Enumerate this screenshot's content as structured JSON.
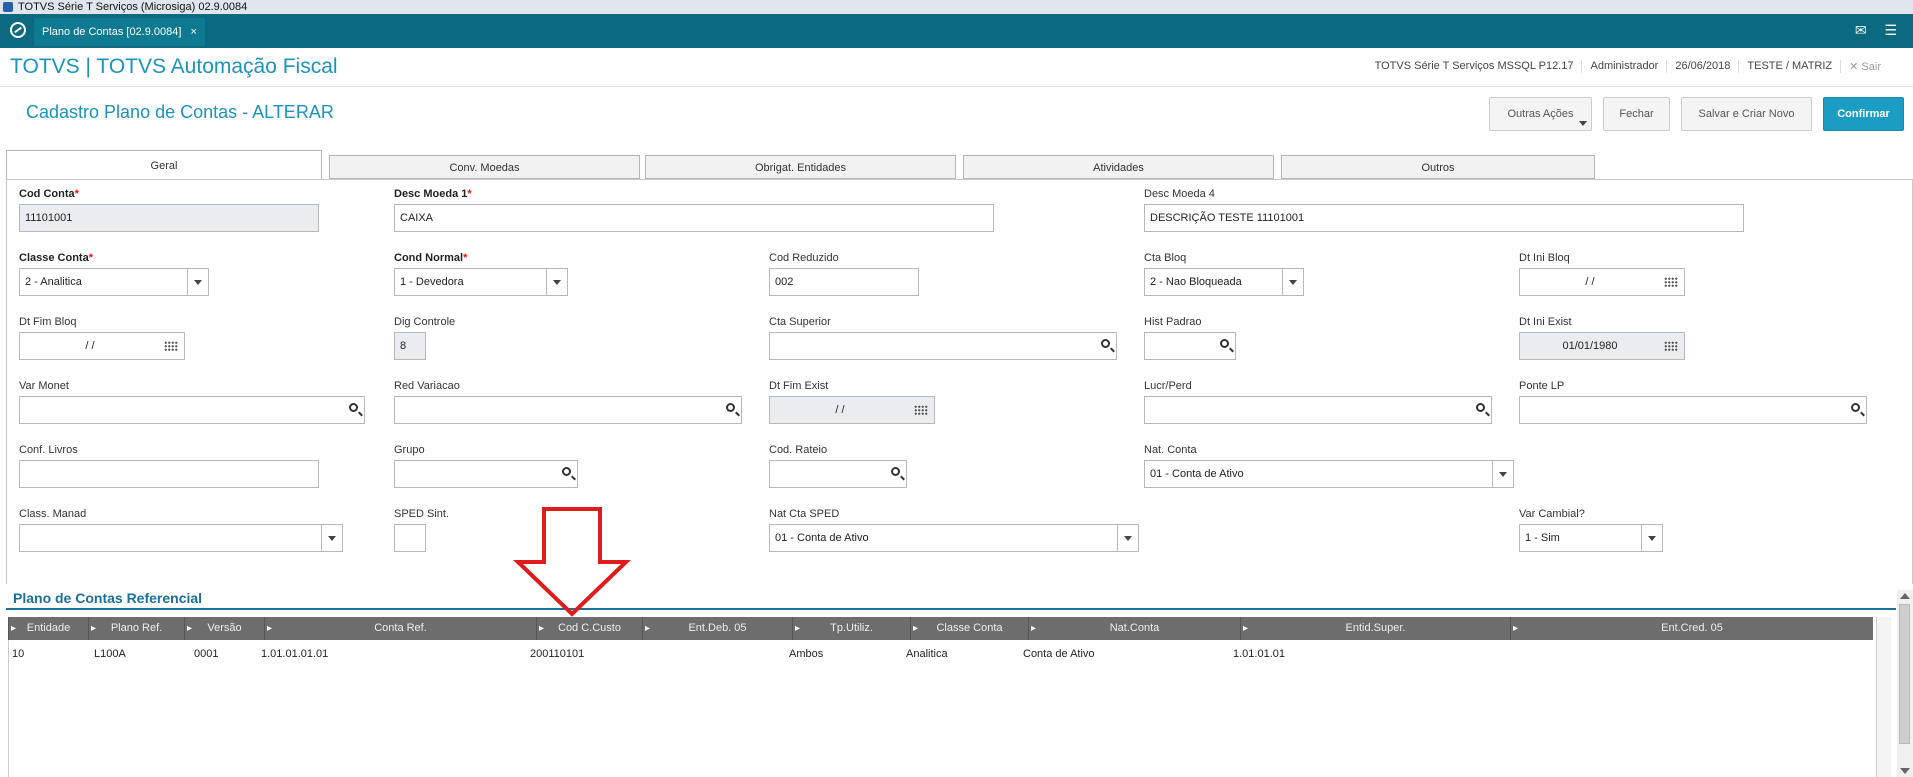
{
  "os": {
    "title": "TOTVS Série T Serviços (Microsiga) 02.9.0084"
  },
  "tabbar": {
    "tab_label": "Plano de Contas [02.9.0084]",
    "tab_close": "×",
    "mail_icon": "✉",
    "menu_icon": "☰"
  },
  "header": {
    "brand": "TOTVS | TOTVS Automação Fiscal",
    "env": "TOTVS Série T Serviços MSSQL P12.17",
    "user": "Administrador",
    "date": "26/06/2018",
    "company": "TESTE / MATRIZ",
    "logout": "✕  Sair"
  },
  "page": {
    "title": "Cadastro Plano de Contas - ALTERAR",
    "buttons": {
      "outras": "Outras Ações",
      "fechar": "Fechar",
      "salvar_novo": "Salvar e Criar Novo",
      "confirmar": "Confirmar"
    }
  },
  "tabs": [
    "Geral",
    "Conv. Moedas",
    "Obrigat. Entidades",
    "Atividades",
    "Outros"
  ],
  "fields": {
    "cod_conta": {
      "label": "Cod Conta",
      "value": "11101001"
    },
    "desc_moeda1": {
      "label": "Desc Moeda 1",
      "value": "CAIXA"
    },
    "desc_moeda4": {
      "label": "Desc Moeda 4",
      "value": "DESCRIÇÃO TESTE 11101001"
    },
    "classe_conta": {
      "label": "Classe Conta",
      "value": "2 - Analitica"
    },
    "cond_normal": {
      "label": "Cond Normal",
      "value": "1 - Devedora"
    },
    "cod_reduzido": {
      "label": "Cod Reduzido",
      "value": "002"
    },
    "cta_bloq": {
      "label": "Cta Bloq",
      "value": "2 - Nao Bloqueada"
    },
    "dt_ini_bloq": {
      "label": "Dt Ini Bloq",
      "value": "/ /"
    },
    "dt_fim_bloq": {
      "label": "Dt Fim Bloq",
      "value": "/ /"
    },
    "dig_controle": {
      "label": "Dig Controle",
      "value": "8"
    },
    "cta_superior": {
      "label": "Cta Superior",
      "value": ""
    },
    "hist_padrao": {
      "label": "Hist Padrao",
      "value": ""
    },
    "dt_ini_exist": {
      "label": "Dt Ini Exist",
      "value": "01/01/1980"
    },
    "var_monet": {
      "label": "Var Monet",
      "value": ""
    },
    "red_variacao": {
      "label": "Red Variacao",
      "value": ""
    },
    "dt_fim_exist": {
      "label": "Dt Fim Exist",
      "value": "/ /"
    },
    "lucr_perd": {
      "label": "Lucr/Perd",
      "value": ""
    },
    "ponte_lp": {
      "label": "Ponte LP",
      "value": ""
    },
    "conf_livros": {
      "label": "Conf. Livros",
      "value": ""
    },
    "grupo": {
      "label": "Grupo",
      "value": ""
    },
    "cod_rateio": {
      "label": "Cod. Rateio",
      "value": ""
    },
    "nat_conta": {
      "label": "Nat. Conta",
      "value": "01 - Conta de Ativo"
    },
    "class_manad": {
      "label": "Class. Manad",
      "value": ""
    },
    "sped_sint": {
      "label": "SPED Sint.",
      "value": ""
    },
    "nat_cta_sped": {
      "label": "Nat Cta SPED",
      "value": "01 - Conta de Ativo"
    },
    "var_cambial": {
      "label": "Var Cambial?",
      "value": "1 - Sim"
    }
  },
  "ref": {
    "title": "Plano de Contas Referencial",
    "columns": [
      "Entidade",
      "Plano Ref.",
      "Versão",
      "Conta Ref.",
      "Cod C.Custo",
      "Ent.Deb. 05",
      "Tp.Utiliz.",
      "Classe Conta",
      "Nat.Conta",
      "Entid.Super.",
      "Ent.Cred. 05"
    ],
    "rows": [
      [
        "10",
        "L100A",
        "0001",
        "1.01.01.01.01",
        "200110101",
        "",
        "Ambos",
        "Analitica",
        "Conta de Ativo",
        "1.01.01.01",
        ""
      ]
    ]
  },
  "colors": {
    "accent": "#1b93bd",
    "tabbar": "#0b6a80",
    "primary_button": "#1b9cc3",
    "annotation_arrow": "#e01b1b"
  },
  "icons": {
    "search": "search-icon",
    "calendar": "calendar-icon",
    "dropdown": "chevron-down-icon",
    "arrow": "down-arrow-annotation"
  }
}
